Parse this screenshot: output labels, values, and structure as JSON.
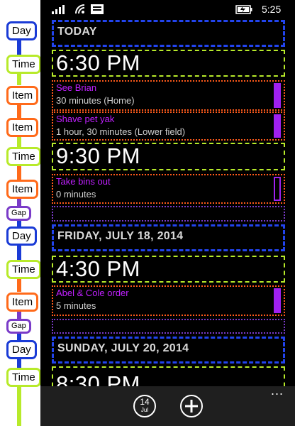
{
  "status_bar": {
    "time": "5:25"
  },
  "legend": {
    "badges": [
      "Day",
      "Time",
      "Item",
      "Item",
      "Time",
      "Item",
      "Gap",
      "Day",
      "Time",
      "Item",
      "Gap",
      "Day",
      "Time"
    ]
  },
  "agenda": {
    "today": "TODAY",
    "time1": "6:30 PM",
    "item1": {
      "title": "See Brian",
      "subtitle": "30 minutes (Home)"
    },
    "item2": {
      "title": "Shave pet yak",
      "subtitle": "1 hour, 30 minutes (Lower field)"
    },
    "time2": "9:30 PM",
    "item3": {
      "title": "Take bins out",
      "subtitle": "0 minutes"
    },
    "day2": "FRIDAY, JULY 18, 2014",
    "time3": "4:30 PM",
    "item4": {
      "title": "Abel & Cole order",
      "subtitle": "5 minutes"
    },
    "day3": "SUNDAY, JULY 20, 2014",
    "time4": "8:30 PM"
  },
  "app_bar": {
    "calendar_day": "14",
    "calendar_month": "Jul",
    "more": "..."
  },
  "colors": {
    "day": "#2244ee",
    "time": "#b7ea2a",
    "item": "#ff5a1a",
    "gap": "#7a3bc8",
    "accent": "#a020f0"
  }
}
